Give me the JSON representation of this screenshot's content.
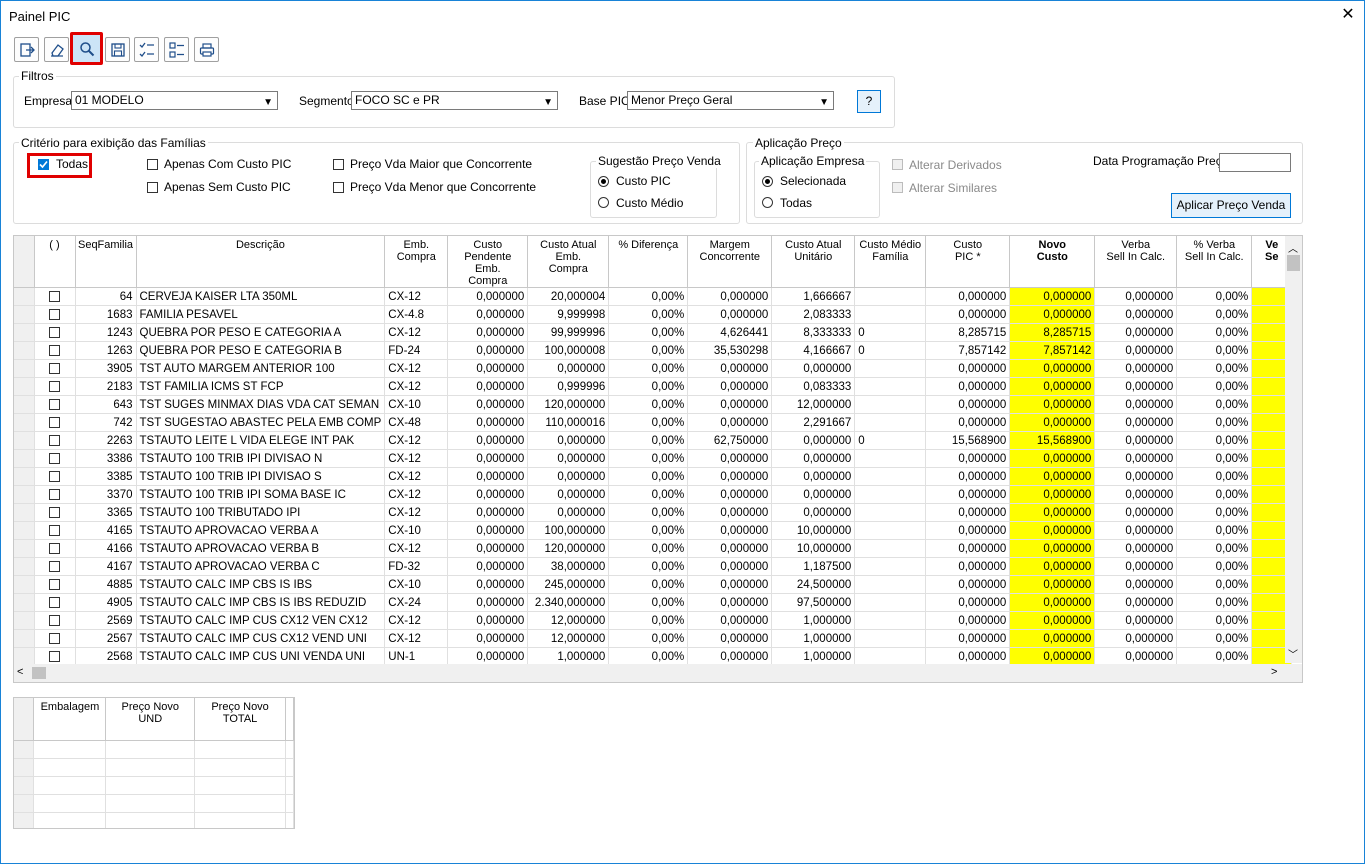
{
  "window": {
    "title": "Painel PIC",
    "close": "✕"
  },
  "filtros": {
    "title": "Filtros",
    "empresa_label": "Empresa",
    "empresa_value": "01 MODELO",
    "segmento_label": "Segmento",
    "segmento_value": "FOCO SC e PR",
    "base_label": "Base PIC",
    "base_value": "Menor Preço Geral",
    "help": "?"
  },
  "criterio": {
    "title": "Critério para exibição das Famílias",
    "todas": "Todas",
    "apenas_com": "Apenas Com Custo PIC",
    "apenas_sem": "Apenas Sem Custo PIC",
    "maior": "Preço Vda Maior que Concorrente",
    "menor": "Preço Vda Menor que Concorrente",
    "sugestao_title": "Sugestão Preço Venda",
    "custo_pic": "Custo PIC",
    "custo_medio": "Custo Médio"
  },
  "aplicacao": {
    "title": "Aplicação Preço",
    "empresa_title": "Aplicação Empresa",
    "selecionada": "Selecionada",
    "todas": "Todas",
    "alterar_derivados": "Alterar Derivados",
    "alterar_similares": "Alterar Similares",
    "data_label": "Data Programação Preço",
    "aplicar": "Aplicar Preço Venda"
  },
  "grid": {
    "headers": [
      "( )",
      "SeqFamilia",
      "Descrição",
      "Emb.\nCompra",
      "Custo\nPendente Emb.\nCompra",
      "Custo Atual\nEmb.\nCompra",
      "% Diferença",
      "Margem\nConcorrente",
      "Custo Atual\nUnitário",
      "Custo Médio\nFamília",
      "Custo\nPIC *",
      "Novo\nCusto",
      "Verba\nSell In Calc.",
      "% Verba\nSell In Calc.",
      "Ve\nSe"
    ],
    "rows": [
      [
        "64",
        "CERVEJA KAISER LTA 350ML",
        "CX-12",
        "0,000000",
        "20,000004",
        "0,00%",
        "0,000000",
        "1,666667",
        "",
        "0,000000",
        "0,000000",
        "0,000000",
        "0,00%"
      ],
      [
        "1683",
        "FAMILIA PESAVEL",
        "CX-4.8",
        "0,000000",
        "9,999998",
        "0,00%",
        "0,000000",
        "2,083333",
        "",
        "0,000000",
        "0,000000",
        "0,000000",
        "0,00%"
      ],
      [
        "1243",
        "QUEBRA POR PESO E CATEGORIA A",
        "CX-12",
        "0,000000",
        "99,999996",
        "0,00%",
        "4,626441",
        "8,333333",
        "0",
        "8,285715",
        "8,285715",
        "0,000000",
        "0,00%"
      ],
      [
        "1263",
        "QUEBRA POR PESO E CATEGORIA B",
        "FD-24",
        "0,000000",
        "100,000008",
        "0,00%",
        "35,530298",
        "4,166667",
        "0",
        "7,857142",
        "7,857142",
        "0,000000",
        "0,00%"
      ],
      [
        "3905",
        "TST AUTO MARGEM ANTERIOR 100",
        "CX-12",
        "0,000000",
        "0,000000",
        "0,00%",
        "0,000000",
        "0,000000",
        "",
        "0,000000",
        "0,000000",
        "0,000000",
        "0,00%"
      ],
      [
        "2183",
        "TST FAMILIA ICMS ST FCP",
        "CX-12",
        "0,000000",
        "0,999996",
        "0,00%",
        "0,000000",
        "0,083333",
        "",
        "0,000000",
        "0,000000",
        "0,000000",
        "0,00%"
      ],
      [
        "643",
        "TST SUGES MINMAX DIAS VDA CAT SEMAN",
        "CX-10",
        "0,000000",
        "120,000000",
        "0,00%",
        "0,000000",
        "12,000000",
        "",
        "0,000000",
        "0,000000",
        "0,000000",
        "0,00%"
      ],
      [
        "742",
        "TST SUGESTAO ABASTEC PELA EMB COMP",
        "CX-48",
        "0,000000",
        "110,000016",
        "0,00%",
        "0,000000",
        "2,291667",
        "",
        "0,000000",
        "0,000000",
        "0,000000",
        "0,00%"
      ],
      [
        "2263",
        "TSTAUTO  LEITE L VIDA ELEGE INT PAK",
        "CX-12",
        "0,000000",
        "0,000000",
        "0,00%",
        "62,750000",
        "0,000000",
        "0",
        "15,568900",
        "15,568900",
        "0,000000",
        "0,00%"
      ],
      [
        "3386",
        "TSTAUTO 100 TRIB IPI DIVISAO N",
        "CX-12",
        "0,000000",
        "0,000000",
        "0,00%",
        "0,000000",
        "0,000000",
        "",
        "0,000000",
        "0,000000",
        "0,000000",
        "0,00%"
      ],
      [
        "3385",
        "TSTAUTO 100 TRIB IPI DIVISAO S",
        "CX-12",
        "0,000000",
        "0,000000",
        "0,00%",
        "0,000000",
        "0,000000",
        "",
        "0,000000",
        "0,000000",
        "0,000000",
        "0,00%"
      ],
      [
        "3370",
        "TSTAUTO 100 TRIB IPI SOMA BASE IC",
        "CX-12",
        "0,000000",
        "0,000000",
        "0,00%",
        "0,000000",
        "0,000000",
        "",
        "0,000000",
        "0,000000",
        "0,000000",
        "0,00%"
      ],
      [
        "3365",
        "TSTAUTO 100 TRIBUTADO IPI",
        "CX-12",
        "0,000000",
        "0,000000",
        "0,00%",
        "0,000000",
        "0,000000",
        "",
        "0,000000",
        "0,000000",
        "0,000000",
        "0,00%"
      ],
      [
        "4165",
        "TSTAUTO APROVACAO VERBA A",
        "CX-10",
        "0,000000",
        "100,000000",
        "0,00%",
        "0,000000",
        "10,000000",
        "",
        "0,000000",
        "0,000000",
        "0,000000",
        "0,00%"
      ],
      [
        "4166",
        "TSTAUTO APROVACAO VERBA B",
        "CX-12",
        "0,000000",
        "120,000000",
        "0,00%",
        "0,000000",
        "10,000000",
        "",
        "0,000000",
        "0,000000",
        "0,000000",
        "0,00%"
      ],
      [
        "4167",
        "TSTAUTO APROVACAO VERBA C",
        "FD-32",
        "0,000000",
        "38,000000",
        "0,00%",
        "0,000000",
        "1,187500",
        "",
        "0,000000",
        "0,000000",
        "0,000000",
        "0,00%"
      ],
      [
        "4885",
        "TSTAUTO CALC IMP CBS IS IBS",
        "CX-10",
        "0,000000",
        "245,000000",
        "0,00%",
        "0,000000",
        "24,500000",
        "",
        "0,000000",
        "0,000000",
        "0,000000",
        "0,00%"
      ],
      [
        "4905",
        "TSTAUTO CALC IMP CBS IS IBS REDUZID",
        "CX-24",
        "0,000000",
        "2.340,000000",
        "0,00%",
        "0,000000",
        "97,500000",
        "",
        "0,000000",
        "0,000000",
        "0,000000",
        "0,00%"
      ],
      [
        "2569",
        "TSTAUTO CALC IMP CUS CX12 VEN CX12",
        "CX-12",
        "0,000000",
        "12,000000",
        "0,00%",
        "0,000000",
        "1,000000",
        "",
        "0,000000",
        "0,000000",
        "0,000000",
        "0,00%"
      ],
      [
        "2567",
        "TSTAUTO CALC IMP CUS CX12 VEND UNI",
        "CX-12",
        "0,000000",
        "12,000000",
        "0,00%",
        "0,000000",
        "1,000000",
        "",
        "0,000000",
        "0,000000",
        "0,000000",
        "0,00%"
      ],
      [
        "2568",
        "TSTAUTO CALC IMP CUS UNI VENDA UNI",
        "UN-1",
        "0,000000",
        "1,000000",
        "0,00%",
        "0,000000",
        "1,000000",
        "",
        "0,000000",
        "0,000000",
        "0,000000",
        "0,00%"
      ]
    ]
  },
  "grid2": {
    "headers": [
      "Embalagem",
      "Preço Novo\nUND",
      "Preço Novo\nTOTAL"
    ]
  },
  "icons": [
    "exit-icon",
    "eraser-icon",
    "search-icon",
    "save-icon",
    "checklist-icon",
    "list-icon",
    "print-icon"
  ],
  "colors": {
    "accent": "#0078d7",
    "highlight": "#ffff00",
    "alert": "#e00000"
  }
}
